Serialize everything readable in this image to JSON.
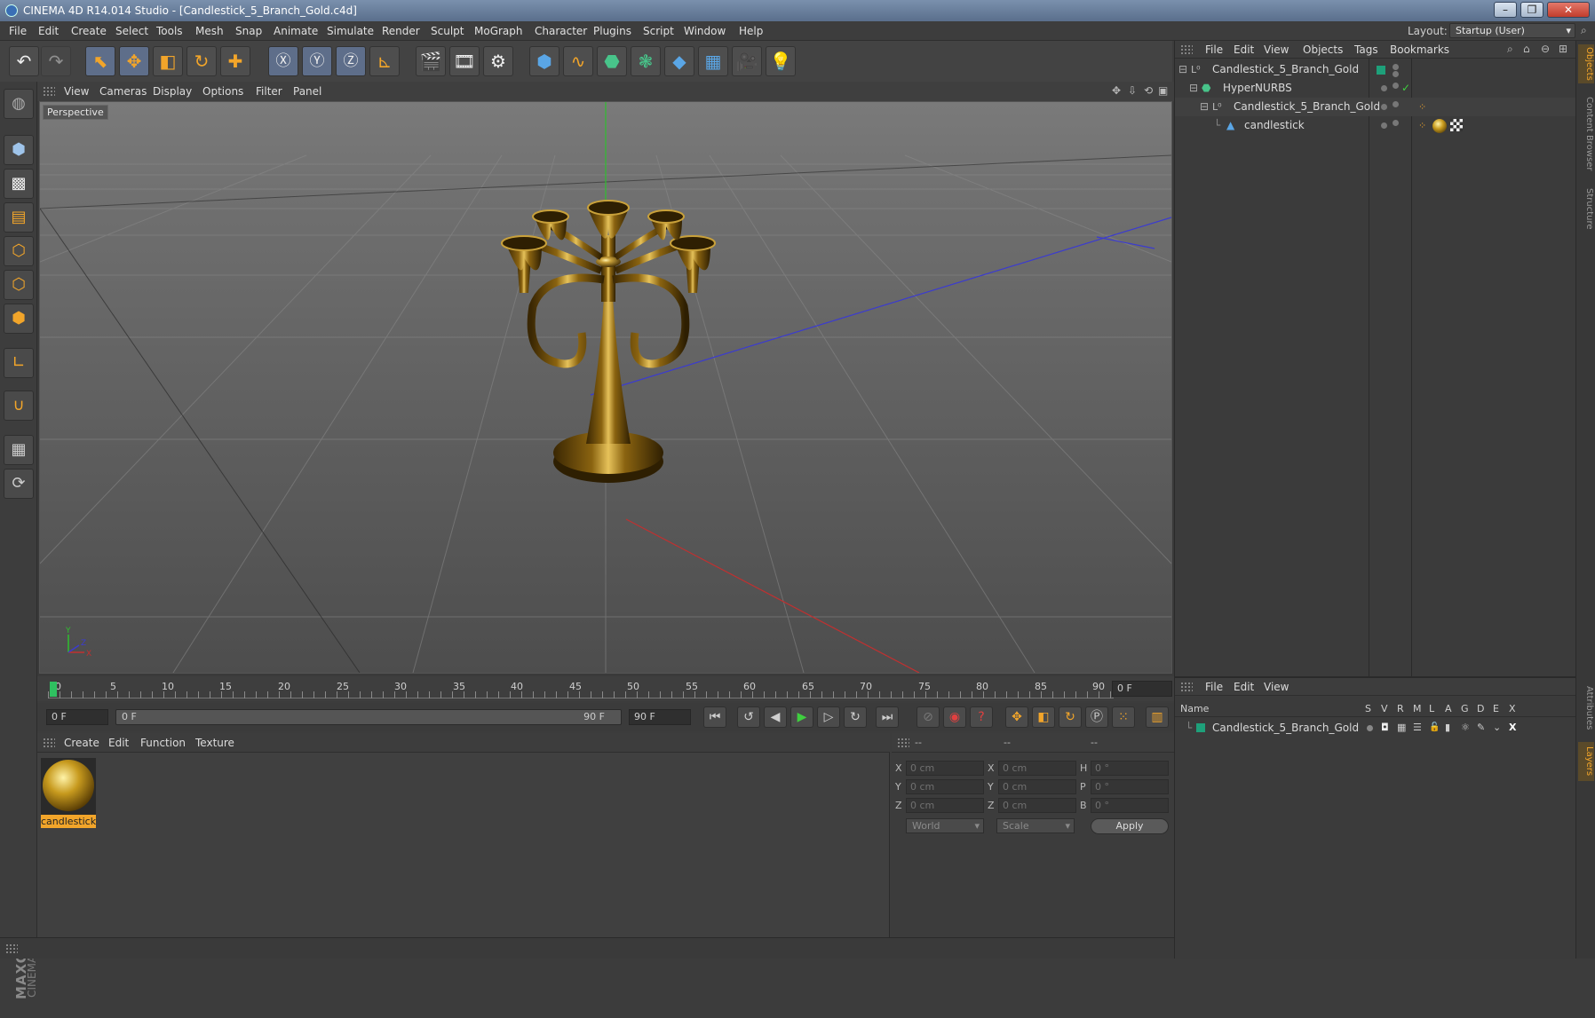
{
  "window": {
    "title": "CINEMA 4D R14.014 Studio - [Candlestick_5_Branch_Gold.c4d]",
    "minimize": "–",
    "restore": "❐",
    "close": "✕"
  },
  "menubar": {
    "items": [
      "File",
      "Edit",
      "Create",
      "Select",
      "Tools",
      "Mesh",
      "Snap",
      "Animate",
      "Simulate",
      "Render",
      "Sculpt",
      "MoGraph",
      "Character",
      "Plugins",
      "Script",
      "Window",
      "Help"
    ],
    "layout_label": "Layout:",
    "layout_value": "Startup (User)"
  },
  "viewport": {
    "menu": [
      "View",
      "Cameras",
      "Display",
      "Options",
      "Filter",
      "Panel"
    ],
    "label": "Perspective"
  },
  "timeline": {
    "ticks": [
      "0",
      "5",
      "10",
      "15",
      "20",
      "25",
      "30",
      "35",
      "40",
      "45",
      "50",
      "55",
      "60",
      "65",
      "70",
      "75",
      "80",
      "85",
      "90"
    ],
    "current_frame": "0 F"
  },
  "transport": {
    "start_field": "0 F",
    "range_left": "0 F",
    "range_right": "90 F",
    "end_field": "90 F"
  },
  "materials": {
    "menu": [
      "Create",
      "Edit",
      "Function",
      "Texture"
    ],
    "items": [
      {
        "name": "candlestick"
      }
    ]
  },
  "coordinates": {
    "headers": [
      "--",
      "--",
      "--"
    ],
    "rows": [
      {
        "axis": "X",
        "pos": "0 cm",
        "axis2": "X",
        "size": "0 cm",
        "axis3": "H",
        "rot": "0 °"
      },
      {
        "axis": "Y",
        "pos": "0 cm",
        "axis2": "Y",
        "size": "0 cm",
        "axis3": "P",
        "rot": "0 °"
      },
      {
        "axis": "Z",
        "pos": "0 cm",
        "axis2": "Z",
        "size": "0 cm",
        "axis3": "B",
        "rot": "0 °"
      }
    ],
    "mode": "World",
    "scale_mode": "Scale",
    "apply": "Apply"
  },
  "objects_panel": {
    "menu": [
      "File",
      "Edit",
      "View",
      "Objects",
      "Tags",
      "Bookmarks"
    ],
    "rows": [
      {
        "name": "Candlestick_5_Branch_Gold",
        "indent": 0
      },
      {
        "name": "HyperNURBS",
        "indent": 1
      },
      {
        "name": "Candlestick_5_Branch_Gold",
        "indent": 2
      },
      {
        "name": "candlestick",
        "indent": 3
      }
    ]
  },
  "layers_panel": {
    "menu": [
      "File",
      "Edit",
      "View"
    ],
    "columns": [
      "Name",
      "S",
      "V",
      "R",
      "M",
      "L",
      "A",
      "G",
      "D",
      "E",
      "X"
    ],
    "rows": [
      {
        "name": "Candlestick_5_Branch_Gold"
      }
    ]
  },
  "right_tabs": [
    "Objects",
    "Content Browser",
    "Structure",
    "Attributes",
    "Layers"
  ],
  "brand": {
    "maxon": "MAXON",
    "product": "CINEMA 4D"
  },
  "colors": {
    "accent_orange": "#f2a52a",
    "selection_blue": "#5e6e8a",
    "layer_teal": "#1ea07a"
  }
}
